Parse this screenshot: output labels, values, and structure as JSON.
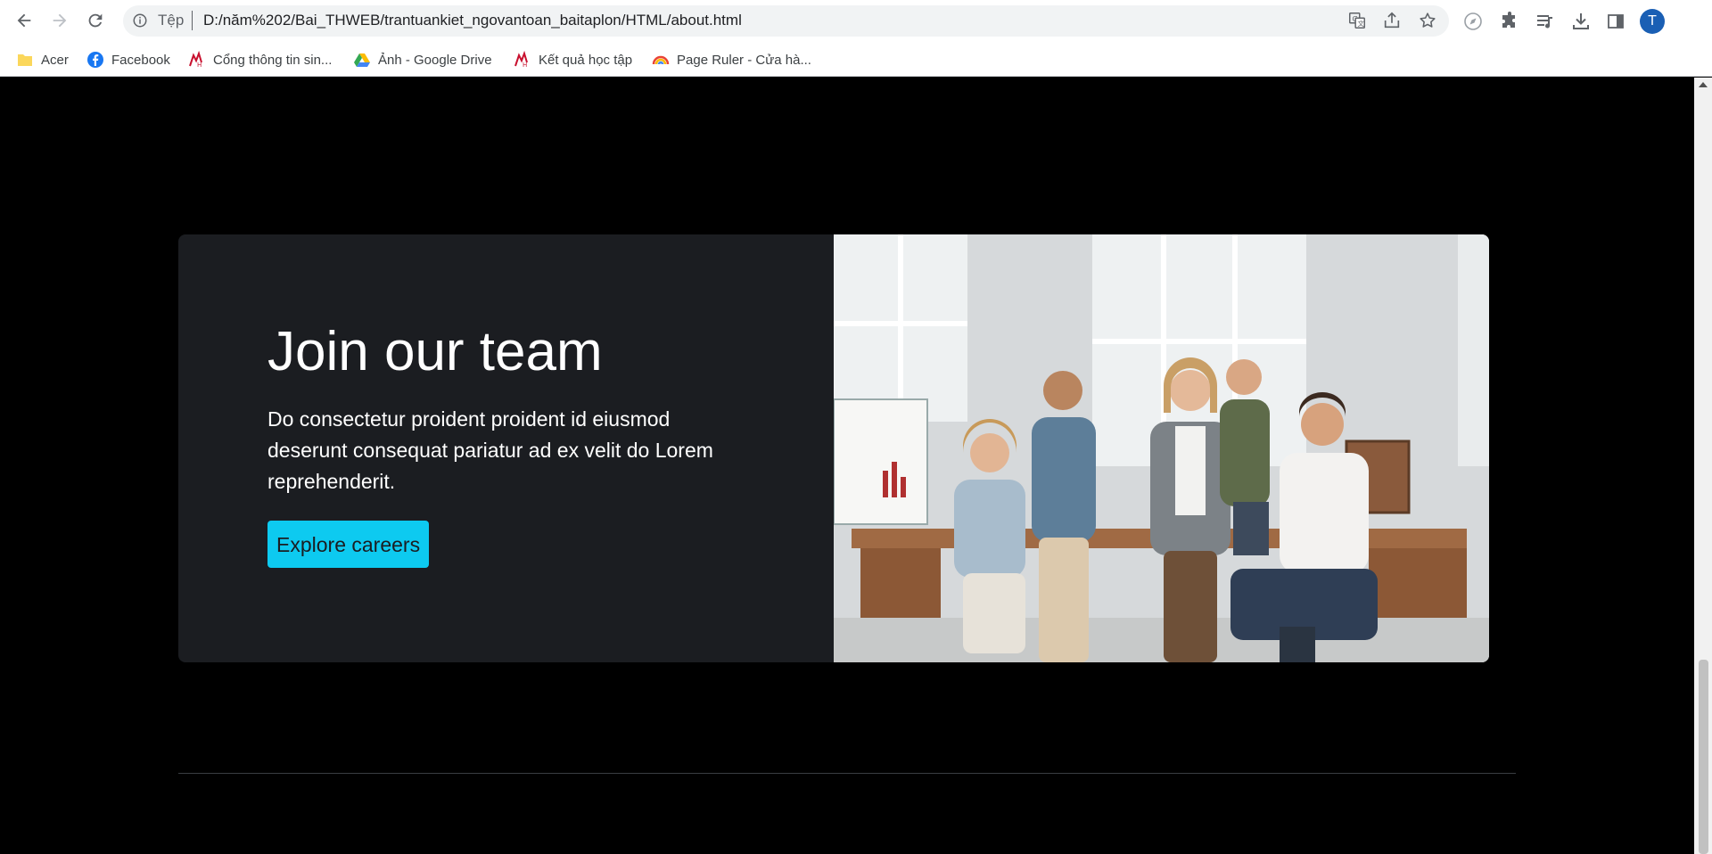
{
  "browser": {
    "url_scheme": "Tệp",
    "url": "D:/năm%202/Bai_THWEB/trantuankiet_ngovantoan_baitaplon/HTML/about.html",
    "profile_initial": "T",
    "bookmarks": [
      {
        "label": "Acer",
        "icon": "folder-icon"
      },
      {
        "label": "Facebook",
        "icon": "facebook-icon"
      },
      {
        "label": "Cổng thông tin sin...",
        "icon": "university-icon"
      },
      {
        "label": "Ảnh - Google Drive",
        "icon": "google-drive-icon"
      },
      {
        "label": "Kết quả học tập",
        "icon": "university-icon"
      },
      {
        "label": "Page Ruler - Cửa hà...",
        "icon": "rainbow-icon"
      }
    ]
  },
  "card": {
    "title": "Join our team",
    "description": "Do consectetur proident proident id eiusmod deserunt consequat pariatur ad ex velit do Lorem reprehenderit.",
    "button_label": "Explore careers"
  },
  "colors": {
    "page_background": "#000000",
    "card_background": "#1b1d21",
    "button_background": "#0dcaf0",
    "avatar": "#1a5fb4"
  }
}
